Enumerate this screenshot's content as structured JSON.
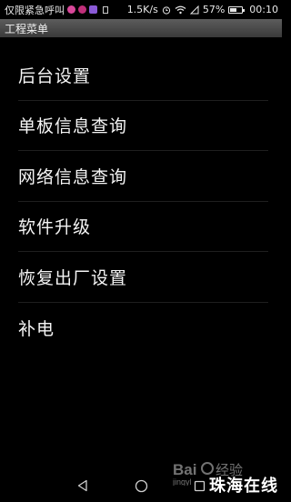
{
  "status_bar": {
    "left_text": "仅限紧急呼叫",
    "network_speed": "1.5K/s",
    "battery_percent": "57%",
    "battery_level": 0.57,
    "time": "00:10",
    "icons": [
      "notification-icon",
      "notification-icon",
      "notification-icon",
      "sim-icon",
      "alarm-icon",
      "wifi-icon",
      "signal-icon",
      "battery-icon"
    ],
    "colors": {
      "dot1": "#d9489a",
      "dot2": "#c02f7a",
      "dot3": "#8a5ad6"
    }
  },
  "title_bar": {
    "title": "工程菜单"
  },
  "menu": {
    "items": [
      {
        "label": "后台设置"
      },
      {
        "label": "单板信息查询"
      },
      {
        "label": "网络信息查询"
      },
      {
        "label": "软件升级"
      },
      {
        "label": "恢复出厂设置"
      },
      {
        "label": "补电"
      }
    ]
  },
  "nav_bar": {
    "buttons": [
      "back-icon",
      "home-icon",
      "recents-icon"
    ]
  },
  "watermark": {
    "logo_text": "Bai经验",
    "sub_text": "jingyl",
    "overlay_text": "珠海在线"
  }
}
